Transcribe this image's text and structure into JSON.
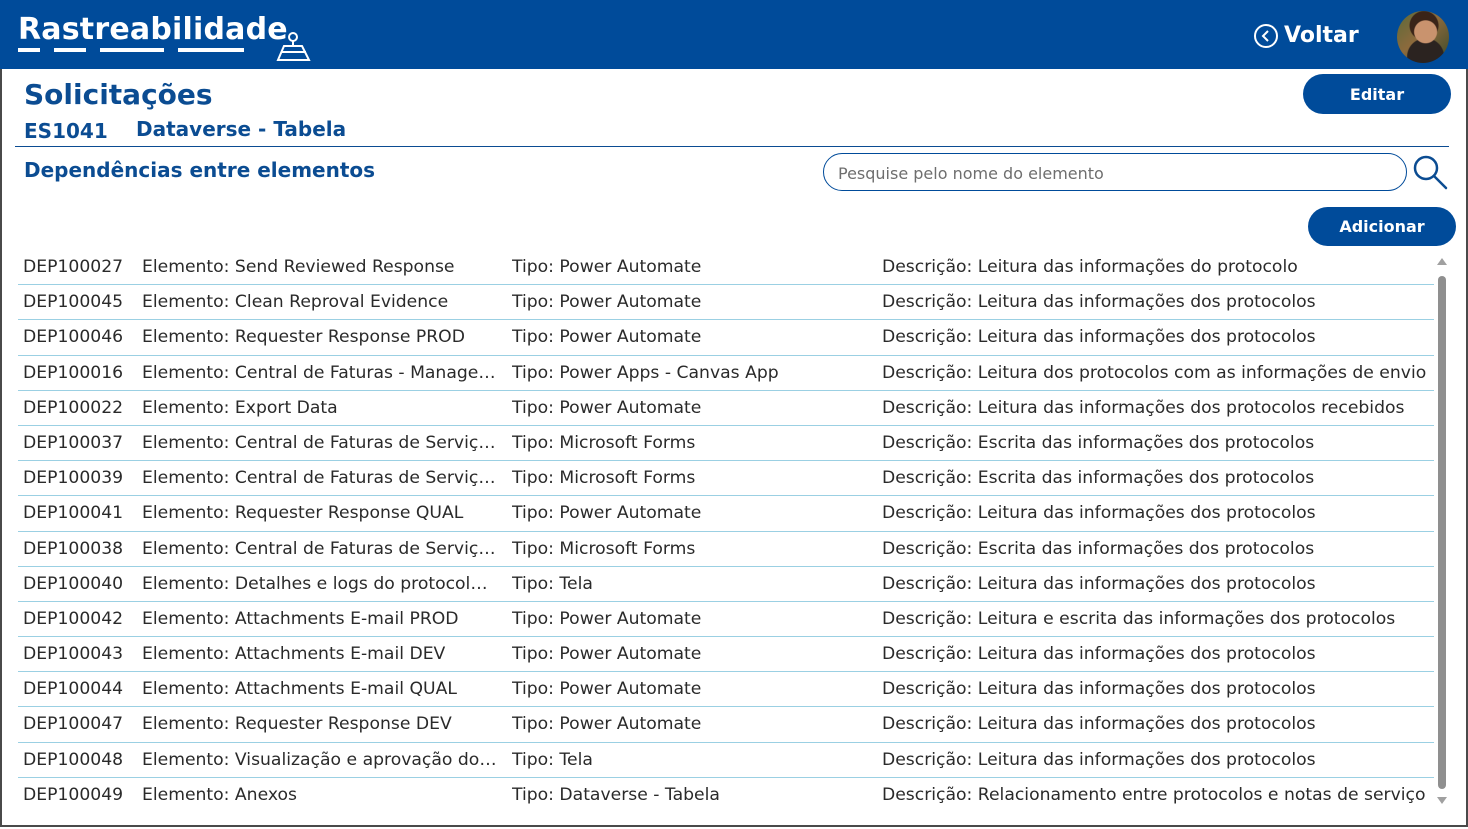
{
  "header": {
    "brand": "Rastreabilidade",
    "brand_icon": "map-pin-icon",
    "back_label": "Voltar",
    "back_icon": "chevron-left-circle-icon",
    "avatar_icon": "user-avatar",
    "background_color": "#004b9a"
  },
  "page": {
    "title": "Solicitações",
    "request_id": "ES1041",
    "request_type": "Dataverse - Tabela",
    "section_title": "Dependências entre elementos",
    "accent_color": "#0b4c92"
  },
  "actions": {
    "edit_label": "Editar",
    "add_label": "Adicionar"
  },
  "search": {
    "placeholder": "Pesquise pelo nome do elemento",
    "value": "",
    "icon": "search-icon"
  },
  "dependencies": [
    {
      "id": "DEP100027",
      "element": "Elemento: Send Reviewed Response",
      "type": "Tipo: Power Automate",
      "description": "Descrição: Leitura das informações do protocolo"
    },
    {
      "id": "DEP100045",
      "element": "Elemento: Clean Reproval Evidence",
      "type": "Tipo: Power Automate",
      "description": "Descrição: Leitura das informações dos protocolos"
    },
    {
      "id": "DEP100046",
      "element": "Elemento: Requester Response PROD",
      "type": "Tipo: Power Automate",
      "description": "Descrição: Leitura das informações dos protocolos"
    },
    {
      "id": "DEP100016",
      "element": "Elemento: Central de Faturas - Managem...",
      "type": "Tipo: Power Apps - Canvas App",
      "description": "Descrição: Leitura dos protocolos com as informações de envio"
    },
    {
      "id": "DEP100022",
      "element": "Elemento: Export Data",
      "type": "Tipo: Power Automate",
      "description": "Descrição: Leitura das informações dos protocolos recebidos"
    },
    {
      "id": "DEP100037",
      "element": "Elemento: Central de Faturas de Serviços...",
      "type": "Tipo: Microsoft Forms",
      "description": "Descrição: Escrita das informações dos protocolos"
    },
    {
      "id": "DEP100039",
      "element": "Elemento: Central de Faturas de Serviços...",
      "type": "Tipo: Microsoft Forms",
      "description": "Descrição: Escrita das informações dos protocolos"
    },
    {
      "id": "DEP100041",
      "element": "Elemento: Requester Response QUAL",
      "type": "Tipo: Power Automate",
      "description": "Descrição: Leitura das informações dos protocolos"
    },
    {
      "id": "DEP100038",
      "element": "Elemento: Central de Faturas de Serviços...",
      "type": "Tipo: Microsoft Forms",
      "description": "Descrição: Escrita das informações dos protocolos"
    },
    {
      "id": "DEP100040",
      "element": "Elemento: Detalhes e logs do protocolo ...",
      "type": "Tipo: Tela",
      "description": "Descrição: Leitura das informações dos protocolos"
    },
    {
      "id": "DEP100042",
      "element": "Elemento: Attachments E-mail PROD",
      "type": "Tipo: Power Automate",
      "description": "Descrição: Leitura e escrita das informações dos protocolos"
    },
    {
      "id": "DEP100043",
      "element": "Elemento: Attachments E-mail DEV",
      "type": "Tipo: Power Automate",
      "description": "Descrição: Leitura das informações dos protocolos"
    },
    {
      "id": "DEP100044",
      "element": "Elemento: Attachments E-mail QUAL",
      "type": "Tipo: Power Automate",
      "description": "Descrição: Leitura das informações dos protocolos"
    },
    {
      "id": "DEP100047",
      "element": "Elemento: Requester Response DEV",
      "type": "Tipo: Power Automate",
      "description": "Descrição: Leitura das informações dos protocolos"
    },
    {
      "id": "DEP100048",
      "element": "Elemento: Visualização e aprovação do p...",
      "type": "Tipo: Tela",
      "description": "Descrição: Leitura das informações dos protocolos"
    },
    {
      "id": "DEP100049",
      "element": "Elemento: Anexos",
      "type": "Tipo: Dataverse - Tabela",
      "description": "Descrição: Relacionamento entre protocolos e notas de serviço"
    }
  ]
}
